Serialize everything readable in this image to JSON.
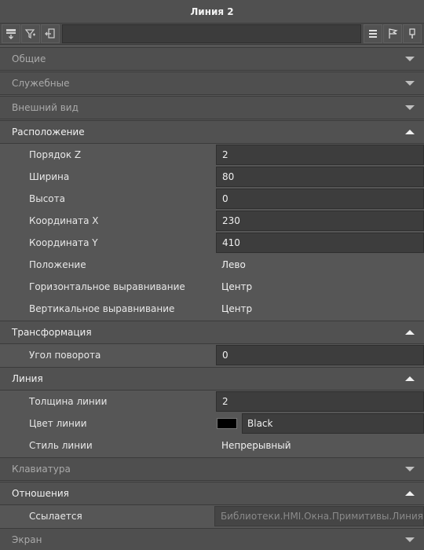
{
  "window": {
    "title": "Линия 2"
  },
  "toolbar": {
    "buttons": [
      "add-event-icon",
      "filter-icon",
      "pin-left-icon",
      "list-icon",
      "flag-icon",
      "pin-icon"
    ]
  },
  "sections": {
    "general": {
      "label": "Общие"
    },
    "service": {
      "label": "Служебные"
    },
    "appearance": {
      "label": "Внешний вид"
    },
    "position": {
      "label": "Расположение",
      "props": {
        "z_order": {
          "name": "Порядок Z",
          "value": "2"
        },
        "width": {
          "name": "Ширина",
          "value": "80"
        },
        "height": {
          "name": "Высота",
          "value": "0"
        },
        "coord_x": {
          "name": "Координата X",
          "value": "230"
        },
        "coord_y": {
          "name": "Координата Y",
          "value": "410"
        },
        "placement": {
          "name": "Положение",
          "value": "Лево"
        },
        "h_align": {
          "name": "Горизонтальное выравнивание",
          "value": "Центр"
        },
        "v_align": {
          "name": "Вертикальное выравнивание",
          "value": "Центр"
        }
      }
    },
    "transform": {
      "label": "Трансформация",
      "props": {
        "rotation": {
          "name": "Угол поворота",
          "value": "0"
        }
      }
    },
    "line": {
      "label": "Линия",
      "props": {
        "thickness": {
          "name": "Толщина линии",
          "value": "2"
        },
        "color": {
          "name": "Цвет линии",
          "value": "Black",
          "swatch": "#000000"
        },
        "style": {
          "name": "Стиль линии",
          "value": "Непрерывный"
        }
      }
    },
    "keyboard": {
      "label": "Клавиатура"
    },
    "relations": {
      "label": "Отношения",
      "props": {
        "refers": {
          "name": "Ссылается",
          "value": "Библиотеки.HMI.Окна.Примитивы.Линия"
        }
      }
    },
    "screen": {
      "label": "Экран"
    }
  }
}
